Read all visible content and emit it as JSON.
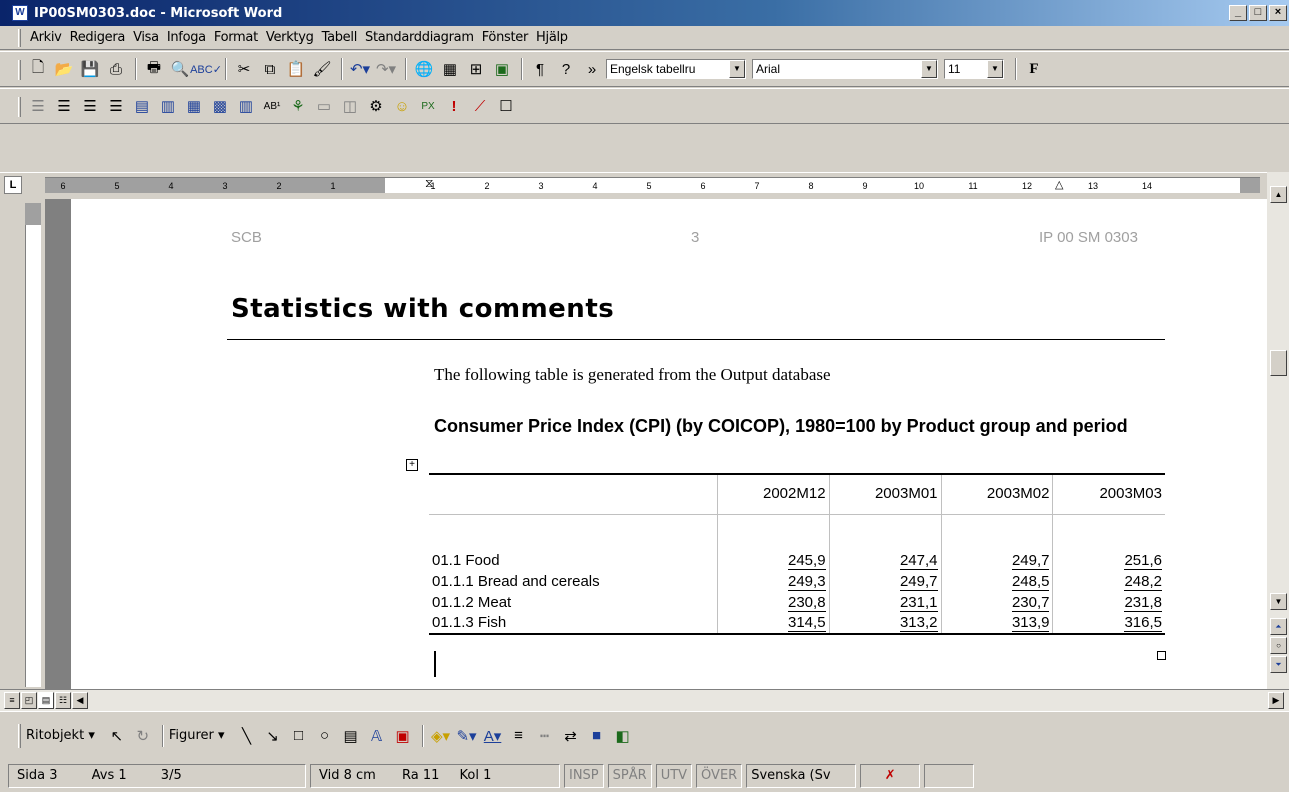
{
  "window": {
    "title": "IP00SM0303.doc - Microsoft Word",
    "app_icon": "W",
    "minimize": "_",
    "maximize": "□",
    "close": "×"
  },
  "menu": [
    "Arkiv",
    "Redigera",
    "Visa",
    "Infoga",
    "Format",
    "Verktyg",
    "Tabell",
    "Standarddiagram",
    "Fönster",
    "Hjälp"
  ],
  "toolbar": {
    "style_combo": "Engelsk tabellru",
    "font_combo": "Arial",
    "size_combo": "11",
    "bold_label": "F",
    "overflow": "»"
  },
  "ruler": {
    "left_numbers": [
      "6",
      "5",
      "4",
      "3",
      "2",
      "1"
    ],
    "right_numbers": [
      "1",
      "2",
      "3",
      "4",
      "5",
      "6",
      "7",
      "8",
      "9",
      "10",
      "11",
      "12",
      "13",
      "14"
    ]
  },
  "document": {
    "header_left": "SCB",
    "header_center": "3",
    "header_right": "IP 00 SM 0303",
    "heading": "Statistics with comments",
    "intro": "The following table is generated from the Output database",
    "table_title": "Consumer Price Index (CPI) (by COICOP), 1980=100 by Product group and period",
    "table": {
      "columns": [
        "2002M12",
        "2003M01",
        "2003M02",
        "2003M03"
      ],
      "rows": [
        {
          "label": "01.1 Food",
          "values": [
            "245,9",
            "247,4",
            "249,7",
            "251,6"
          ]
        },
        {
          "label": "01.1.1 Bread and cereals",
          "values": [
            "249,3",
            "249,7",
            "248,5",
            "248,2"
          ]
        },
        {
          "label": "01.1.2 Meat",
          "values": [
            "230,8",
            "231,1",
            "230,7",
            "231,8"
          ]
        },
        {
          "label": "01.1.3 Fish",
          "values": [
            "314,5",
            "313,2",
            "313,9",
            "316,5"
          ]
        }
      ]
    }
  },
  "drawbar": {
    "ritobjekt": "Ritobjekt ▾",
    "figurer": "Figurer ▾"
  },
  "status": {
    "sida": "Sida 3",
    "avs": "Avs 1",
    "pages": "3/5",
    "vid": "Vid 8 cm",
    "ra": "Ra 11",
    "kol": "Kol 1",
    "insp": "INSP",
    "spar": "SPÅR",
    "utv": "UTV",
    "over": "ÖVER",
    "lang": "Svenska (Sv"
  }
}
